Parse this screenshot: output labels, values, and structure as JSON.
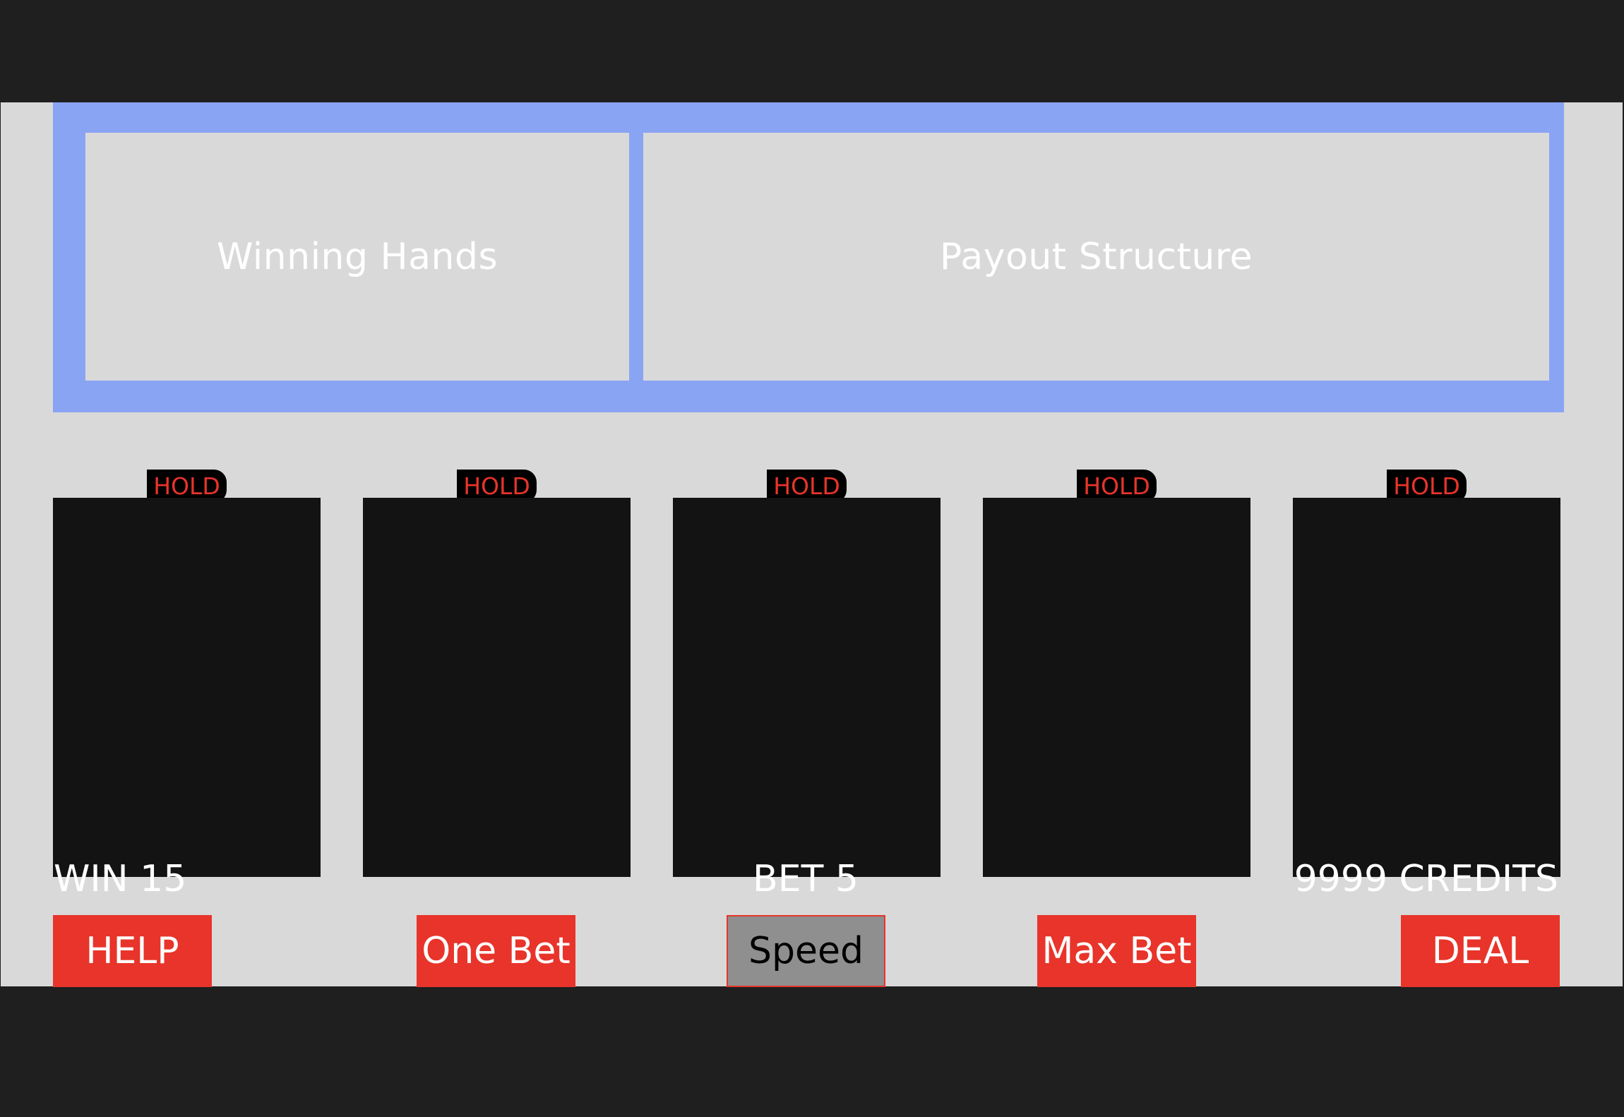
{
  "info_panel": {
    "winning_hands_label": "Winning Hands",
    "payout_structure_label": "Payout Structure"
  },
  "cards": [
    {
      "hold_label": "HOLD"
    },
    {
      "hold_label": "HOLD"
    },
    {
      "hold_label": "HOLD"
    },
    {
      "hold_label": "HOLD"
    },
    {
      "hold_label": "HOLD"
    }
  ],
  "status": {
    "win": "WIN 15",
    "bet": "BET 5",
    "credits": "9999 CREDITS"
  },
  "buttons": {
    "help": "HELP",
    "one_bet": "One Bet",
    "speed": "Speed",
    "max_bet": "Max Bet",
    "deal": "DEAL"
  },
  "colors": {
    "panel_accent": "#8aa4f4",
    "button_red": "#e8342a",
    "speed_gray": "#8f8f8f",
    "card_back": "#131313",
    "table_gray": "#d9d9d9"
  }
}
